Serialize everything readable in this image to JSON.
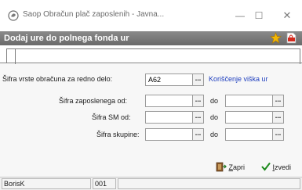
{
  "window": {
    "title": "Saop Obračun plač zaposlenih - Javna...",
    "minimize": "—",
    "maximize": "☐",
    "close": "✕"
  },
  "header": {
    "title": "Dodaj ure do polnega fonda ur",
    "icons": [
      "star-icon",
      "pdf-icon"
    ]
  },
  "form": {
    "row1": {
      "label": "Šifra vrste obračuna za redno delo:",
      "value": "A62",
      "link": "Koriščenje viška ur"
    },
    "row2": {
      "label": "Šifra zaposlenega od:",
      "value_from": "",
      "to_label": "do",
      "value_to": ""
    },
    "row3": {
      "label": "Šifra SM od:",
      "value_from": "",
      "to_label": "do",
      "value_to": ""
    },
    "row4": {
      "label": "Šifra skupine:",
      "value_from": "",
      "to_label": "do",
      "value_to": ""
    },
    "ellipsis": "..."
  },
  "buttons": {
    "close_prefix": "",
    "close_ul": "Z",
    "close_rest": "apri",
    "run_ul": "I",
    "run_rest": "zvedi"
  },
  "status": {
    "user": "BorisK",
    "code": "001",
    "extra": ""
  }
}
